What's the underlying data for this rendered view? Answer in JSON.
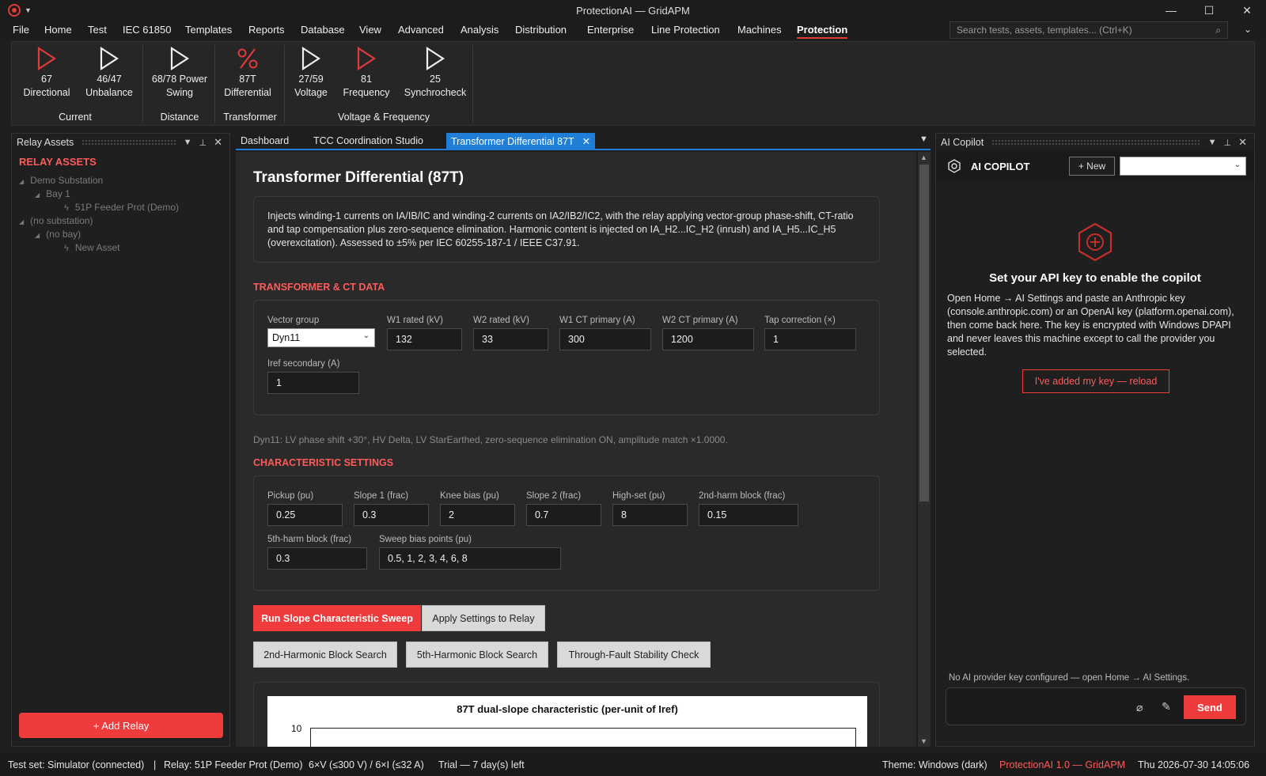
{
  "window": {
    "title": "ProtectionAI — GridAPM",
    "minimize": "—",
    "maximize": "☐",
    "close": "✕"
  },
  "menu": {
    "items": [
      "File",
      "Home",
      "Test",
      "IEC 61850",
      "Templates",
      "Reports",
      "Database",
      "View",
      "Advanced",
      "Analysis",
      "Distribution",
      "Enterprise",
      "Line Protection",
      "Machines",
      "Protection"
    ],
    "active": "Protection",
    "search_placeholder": "Search tests, assets, templates... (Ctrl+K)"
  },
  "ribbon": {
    "buttons": [
      {
        "num": "67",
        "label": "Directional",
        "icon": "play-triangle-red"
      },
      {
        "num": "46/47",
        "label": "Unbalance",
        "icon": "play-triangle-white"
      },
      {
        "num": "68/78 Power",
        "label": "Swing",
        "icon": "play-triangle-white"
      },
      {
        "num": "87T",
        "label": "Differential",
        "icon": "percent-red"
      },
      {
        "num": "27/59",
        "label": "Voltage",
        "icon": "play-triangle-white"
      },
      {
        "num": "81",
        "label": "Frequency",
        "icon": "play-triangle-red"
      },
      {
        "num": "25",
        "label": "Synchrocheck",
        "icon": "play-triangle-white"
      }
    ],
    "groups": [
      "Current",
      "Distance",
      "Transformer",
      "Voltage & Frequency"
    ]
  },
  "left_panel": {
    "title": "Relay Assets",
    "heading": "RELAY ASSETS",
    "tree": [
      {
        "label": "Demo Substation"
      },
      {
        "label": "Bay 1"
      },
      {
        "label": "51P Feeder Prot (Demo)"
      },
      {
        "label": "(no substation)"
      },
      {
        "label": "(no bay)"
      },
      {
        "label": "New Asset"
      }
    ],
    "add_button": "+ Add Relay"
  },
  "tabs": [
    {
      "label": "Dashboard"
    },
    {
      "label": "TCC Coordination Studio"
    },
    {
      "label": "Transformer Differential 87T",
      "close": "✕"
    }
  ],
  "main": {
    "title": "Transformer Differential (87T)",
    "description": "Injects winding-1 currents on IA/IB/IC and winding-2 currents on IA2/IB2/IC2, with the relay applying vector-group phase-shift, CT-ratio and tap compensation plus zero-sequence elimination. Harmonic content is injected on IA_H2...IC_H2 (inrush) and IA_H5...IC_H5 (overexcitation). Assessed to ±5% per IEC 60255-187-1 / IEEE C37.91.",
    "ct_section": "TRANSFORMER & CT DATA",
    "ct_fields": {
      "vector_group": {
        "label": "Vector group",
        "value": "Dyn11"
      },
      "w1_rated": {
        "label": "W1 rated (kV)",
        "value": "132"
      },
      "w2_rated": {
        "label": "W2 rated (kV)",
        "value": "33"
      },
      "w1_ct": {
        "label": "W1 CT primary (A)",
        "value": "300"
      },
      "w2_ct": {
        "label": "W2 CT primary (A)",
        "value": "1200"
      },
      "tap": {
        "label": "Tap correction (×)",
        "value": "1"
      },
      "iref": {
        "label": "Iref secondary (A)",
        "value": "1"
      }
    },
    "vector_note": "Dyn11: LV phase shift +30°, HV Delta, LV StarEarthed, zero-sequence elimination ON, amplitude match ×1.0000.",
    "char_section": "CHARACTERISTIC SETTINGS",
    "char_fields": {
      "pickup": {
        "label": "Pickup (pu)",
        "value": "0.25"
      },
      "slope1": {
        "label": "Slope 1 (frac)",
        "value": "0.3"
      },
      "knee": {
        "label": "Knee bias (pu)",
        "value": "2"
      },
      "slope2": {
        "label": "Slope 2 (frac)",
        "value": "0.7"
      },
      "highset": {
        "label": "High-set (pu)",
        "value": "8"
      },
      "h2block": {
        "label": "2nd-harm block (frac)",
        "value": "0.15"
      },
      "h5block": {
        "label": "5th-harm block (frac)",
        "value": "0.3"
      },
      "sweep": {
        "label": "Sweep bias points (pu)",
        "value": "0.5, 1, 2, 3, 4, 6, 8"
      }
    },
    "buttons": {
      "run_sweep": "Run Slope Characteristic Sweep",
      "apply": "Apply Settings to Relay",
      "h2_search": "2nd-Harmonic Block Search",
      "h5_search": "5th-Harmonic Block Search",
      "through_fault": "Through-Fault Stability Check"
    },
    "chart": {
      "title": "87T dual-slope characteristic (per-unit of Iref)",
      "ytick_top": "10"
    }
  },
  "right_panel": {
    "title": "AI Copilot",
    "header": "AI COPILOT",
    "new_button": "+ New",
    "empty_title": "Set your API key to enable the copilot",
    "empty_body": "Open Home → AI Settings and paste an Anthropic key (console.anthropic.com) or an OpenAI key (platform.openai.com), then come back here. The key is encrypted with Windows DPAPI and never leaves this machine except to call the provider you selected.",
    "reload_button": "I've added my key — reload",
    "no_key_note": "No AI provider key configured — open Home → AI Settings.",
    "send_button": "Send"
  },
  "status": {
    "test_set": "Test set: Simulator (connected)",
    "sep": "|",
    "relay": "Relay: 51P Feeder Prot (Demo)",
    "channels": "6×V (≤300 V) / 6×I (≤32 A)",
    "trial": "Trial — 7 day(s) left",
    "theme": "Theme: Windows (dark)",
    "version": "ProtectionAI 1.0 — GridAPM",
    "clock": "Thu 2026-07-30 14:05:06"
  },
  "colors": {
    "accent_red": "#ef3b3b",
    "tab_blue": "#1f7fd6"
  }
}
